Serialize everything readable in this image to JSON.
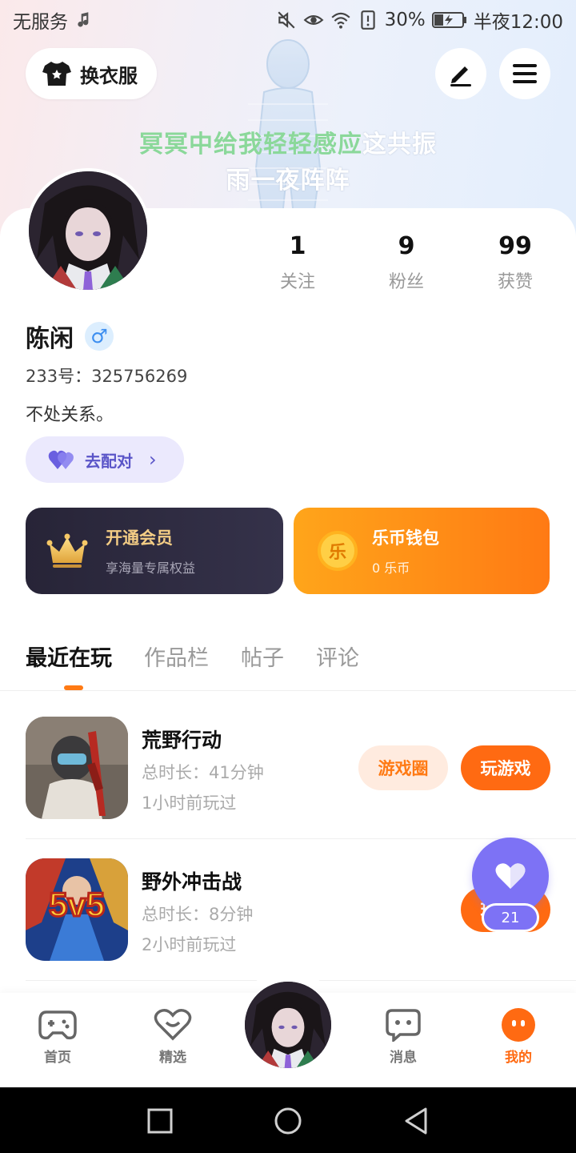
{
  "status_bar": {
    "carrier": "无服务",
    "battery": "30%",
    "time": "半夜12:00"
  },
  "header": {
    "outfit_label": "换衣服",
    "edit_icon": "pen-icon",
    "menu_icon": "menu-icon"
  },
  "lyrics": {
    "line1_highlight": "冥冥中给我轻轻感应",
    "line1_rest": "这共振",
    "line2": "雨一夜阵阵"
  },
  "profile": {
    "stats": [
      {
        "value": "1",
        "label": "关注"
      },
      {
        "value": "9",
        "label": "粉丝"
      },
      {
        "value": "99",
        "label": "获赞"
      }
    ],
    "name": "陈闲",
    "gender_symbol": "♂",
    "id_text": "233号：325756269",
    "bio": "不处关系。",
    "match_label": "去配对"
  },
  "promo": {
    "vip_title": "开通会员",
    "vip_sub": "享海量专属权益",
    "coin_title": "乐币钱包",
    "coin_sub": "0 乐币",
    "coin_glyph": "乐"
  },
  "tabs": [
    "最近在玩",
    "作品栏",
    "帖子",
    "评论"
  ],
  "active_tab": "最近在玩",
  "games": [
    {
      "name": "荒野行动",
      "duration": "总时长：41分钟",
      "last_played": "1小时前玩过",
      "circle_label": "游戏圈",
      "play_label": "玩游戏"
    },
    {
      "name": "野外冲击战",
      "duration": "总时长：8分钟",
      "last_played": "2小时前玩过",
      "play_label": "玩游戏",
      "icon_text": "5v5"
    }
  ],
  "like_float": {
    "count": "21"
  },
  "bottom_nav": [
    {
      "label": "首页",
      "icon": "gamepad-icon"
    },
    {
      "label": "精选",
      "icon": "heart-chat-icon"
    },
    {
      "label": "消息",
      "icon": "message-icon"
    },
    {
      "label": "我的",
      "icon": "profile-face-icon"
    }
  ],
  "colors": {
    "accent": "#ff6a12",
    "purple": "#7d72f5",
    "gold": "#f4cd85"
  }
}
